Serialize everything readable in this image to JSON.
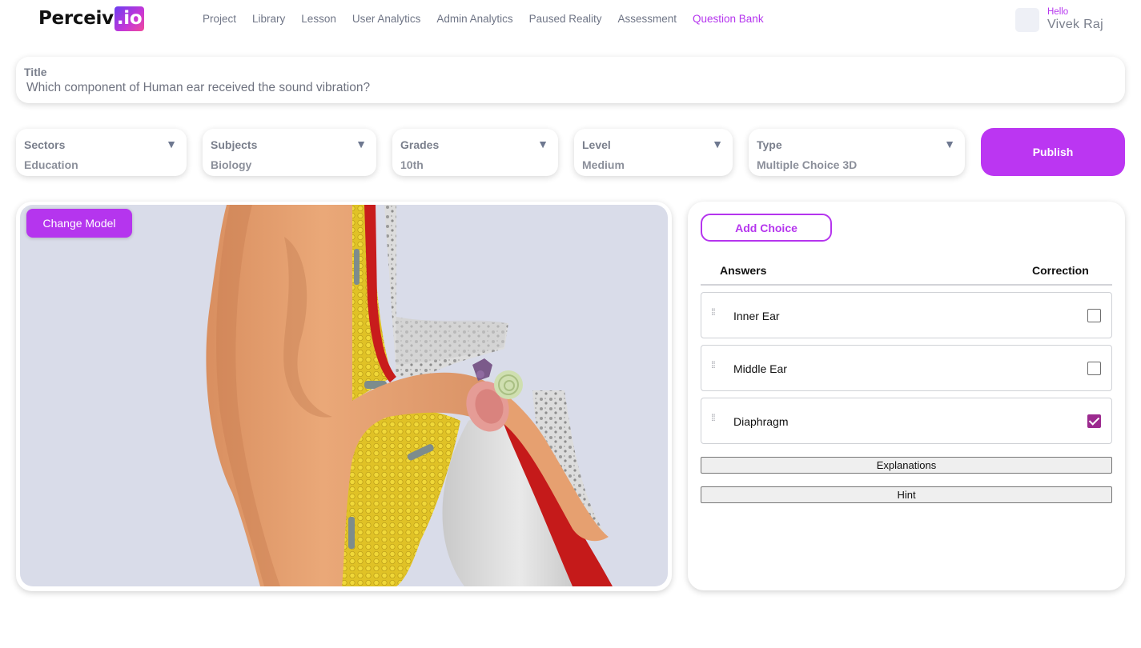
{
  "header": {
    "logo_text": "Perceiv",
    "logo_suffix": ".io",
    "nav": [
      {
        "label": "Project",
        "active": false
      },
      {
        "label": "Library",
        "active": false
      },
      {
        "label": "Lesson",
        "active": false
      },
      {
        "label": "User Analytics",
        "active": false
      },
      {
        "label": "Admin Analytics",
        "active": false
      },
      {
        "label": "Paused Reality",
        "active": false
      },
      {
        "label": "Assessment",
        "active": false
      },
      {
        "label": "Question Bank",
        "active": true
      }
    ],
    "user": {
      "greeting": "Hello",
      "name": "Vivek Raj"
    }
  },
  "title": {
    "label": "Title",
    "value": "Which component of Human ear received the sound vibration?"
  },
  "filters": [
    {
      "label": "Sectors",
      "value": "Education"
    },
    {
      "label": "Subjects",
      "value": "Biology"
    },
    {
      "label": "Grades",
      "value": "10th"
    },
    {
      "label": "Level",
      "value": "Medium"
    },
    {
      "label": "Type",
      "value": "Multiple Choice 3D"
    }
  ],
  "publish_label": "Publish",
  "viewer": {
    "change_model_label": "Change Model"
  },
  "answers": {
    "add_choice_label": "Add Choice",
    "col_answers": "Answers",
    "col_correction": "Correction",
    "choices": [
      {
        "text": "Inner Ear",
        "correct": false
      },
      {
        "text": "Middle Ear",
        "correct": false
      },
      {
        "text": "Diaphragm",
        "correct": true
      }
    ],
    "explanations_label": "Explanations",
    "hint_label": "Hint"
  },
  "colors": {
    "accent": "#b535ee",
    "checkbox_checked": "#9c2a8f",
    "viewport_bg": "#d9dce9"
  }
}
